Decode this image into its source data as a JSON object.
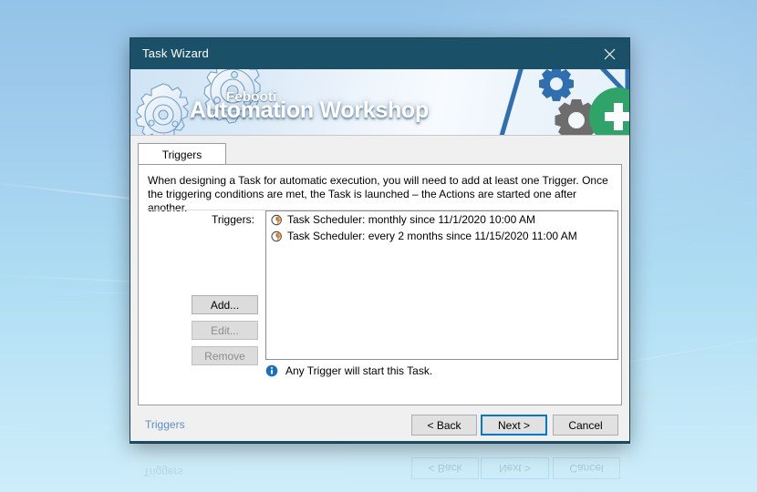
{
  "window": {
    "title": "Task Wizard",
    "close_icon": "close-icon",
    "titlebar_color": "#1b5168"
  },
  "banner": {
    "brand_small": "Febooti",
    "brand_large": "Automation Workshop",
    "left_graphic": "gears-watermark",
    "right_graphic": "gears-and-green-plus"
  },
  "tabs": [
    {
      "label": "Triggers",
      "active": true
    }
  ],
  "main": {
    "description": "When designing a Task for automatic execution, you will need to add at least one Trigger. Once the triggering conditions are met, the Task is launched – the Actions are started one after another.",
    "list_label": "Triggers:",
    "triggers": [
      {
        "icon": "clock-lightning-icon",
        "text": "Task Scheduler: monthly since 11/1/2020 10:00 AM"
      },
      {
        "icon": "clock-lightning-icon",
        "text": "Task Scheduler: every 2 months since 11/15/2020 11:00 AM"
      }
    ],
    "side_buttons": [
      {
        "label": "Add...",
        "enabled": true
      },
      {
        "label": "Edit...",
        "enabled": false
      },
      {
        "label": "Remove",
        "enabled": false
      }
    ],
    "info": {
      "icon": "info-icon",
      "text": "Any Trigger will start this Task."
    }
  },
  "footer": {
    "link": "Triggers",
    "back": "< Back",
    "next": "Next >",
    "cancel": "Cancel",
    "focus_color": "#0078d7"
  },
  "ghost": {
    "link": "Triggers",
    "back": "< Back",
    "next": "Next >",
    "cancel": "Cancel"
  }
}
